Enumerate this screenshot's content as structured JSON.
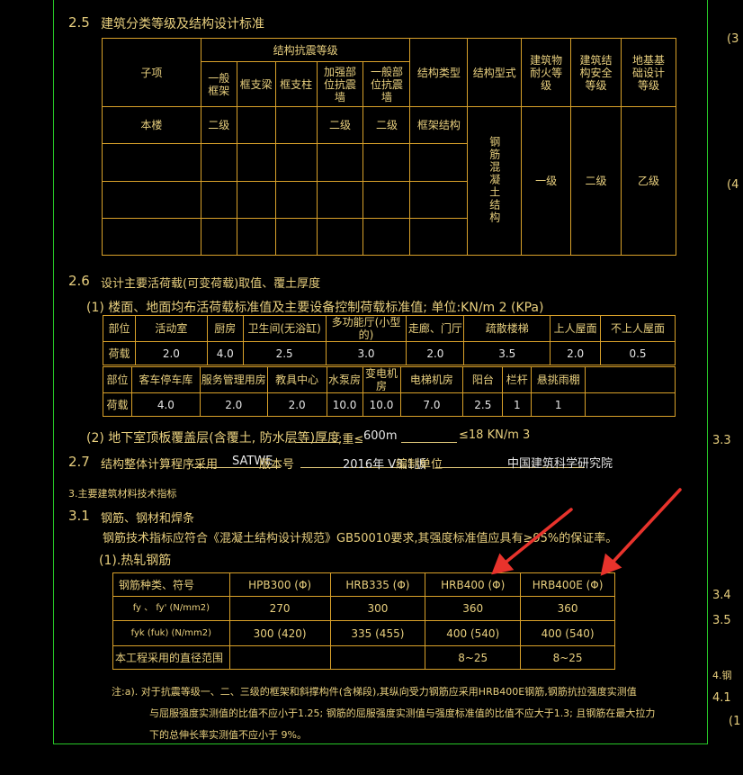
{
  "top_cut": "─ ── ─ ────",
  "s25": {
    "num": "2.5",
    "title": "建筑分类等级及结构设计标准",
    "h_item": "子项",
    "h_seismic": "结构抗震等级",
    "h_sub": [
      "一般框架",
      "框支梁",
      "框支柱",
      "加强部位抗震墙",
      "一般部位抗震墙"
    ],
    "h_struct_type": "结构类型",
    "h_struct_form": "结构型式",
    "h_fire": "建筑物耐火等级",
    "h_safety": "建筑结构安全等级",
    "h_found": "地基基础设计等级",
    "r_item": "本楼",
    "r_frame": "二级",
    "r_strong": "二级",
    "r_general": "二级",
    "r_type": "框架结构",
    "r_form": "钢筋混凝土结构",
    "r_fire": "一级",
    "r_safety": "二级",
    "r_found": "乙级"
  },
  "s26": {
    "num": "2.6",
    "title": "设计主要活荷载(可变荷载)取值、覆土厚度",
    "sub1": "(1) 楼面、地面均布活荷载标准值及主要设备控制荷载标准值; 单位:KN/m 2 (KPa)",
    "t1_labels": [
      "部位",
      "活动室",
      "厨房",
      "卫生间(无浴缸)",
      "多功能厅(小型的)",
      "走廊、门厅",
      "疏散楼梯",
      "上人屋面",
      "不上人屋面"
    ],
    "t1_row_label": "荷载",
    "t1_values": [
      "2.0",
      "4.0",
      "2.5",
      "3.0",
      "2.0",
      "3.5",
      "2.0",
      "0.5"
    ],
    "t2_labels": [
      "部位",
      "客车停车库",
      "服务管理用房",
      "教具中心",
      "水泵房",
      "变电机房",
      "电梯机房",
      "阳台",
      "栏杆",
      "悬挑雨棚",
      ""
    ],
    "t2_row_label": "荷载",
    "t2_values": [
      "4.0",
      "2.0",
      "2.0",
      "10.0",
      "10.0",
      "7.0",
      "2.5",
      "1",
      "1",
      ""
    ],
    "sub2_a": "(2) 地下室顶板覆盖层(含覆土, 防水层等)厚度",
    "sub2_b": ";重≤",
    "sub2_c": "600m",
    "sub2_d": "≤18 KN/m 3"
  },
  "s27": {
    "num": "2.7",
    "title": "结构整体计算程序采用",
    "prog": "SATWE",
    "ver_label": "版本号",
    "ver": "2016年 V3.1版",
    "unit_label": "编制单位",
    "unit": "中国建筑科学研究院"
  },
  "s3": {
    "head": "3.主要建筑材料技术指标",
    "num31": "3.1",
    "title31": "钢筋、钢材和焊条",
    "desc": "钢筋技术指标应符合《混凝土结构设计规范》GB50010要求,其强度标准值应具有≥95%的保证率。",
    "sub1": "(1).热轧钢筋",
    "rebar_head": [
      "钢筋种类、符号",
      "HPB300 (Φ)",
      "HRB335 (Φ)",
      "HRB400 (Φ)",
      "HRB400E (Φ)"
    ],
    "rebar_rows": [
      {
        "label": "fy 、 fy' (N/mm2)",
        "vals": [
          "270",
          "300",
          "360",
          "360"
        ]
      },
      {
        "label": "fyk (fuk) (N/mm2)",
        "vals": [
          "300 (420)",
          "335 (455)",
          "400 (540)",
          "400 (540)"
        ]
      },
      {
        "label": "本工程采用的直径范围",
        "vals": [
          "",
          "",
          "8~25",
          "8~25"
        ]
      }
    ],
    "note1": "注:a). 对于抗震等级一、二、三级的框架和斜撑构件(含梯段),其纵向受力钢筋应采用HRB400E钢筋,钢筋抗拉强度实测值",
    "note2": "与屈服强度实测值的比值不应小于1.25; 钢筋的屈服强度实测值与强度标准值的比值不应大于1.3; 且钢筋在最大拉力",
    "note3": "下的总伸长率实测值不应小于 9%。"
  },
  "right_margin": {
    "a": "(3",
    "b": "(4",
    "c": "3.3",
    "d": "3.4",
    "e": "3.5",
    "f": "4.钢",
    "g": "4.1",
    "h": "(1"
  },
  "colors": {
    "frame": "#27c727",
    "text": "#e8cf7e",
    "grid": "#d9a12a",
    "arrow": "#e8332c"
  }
}
